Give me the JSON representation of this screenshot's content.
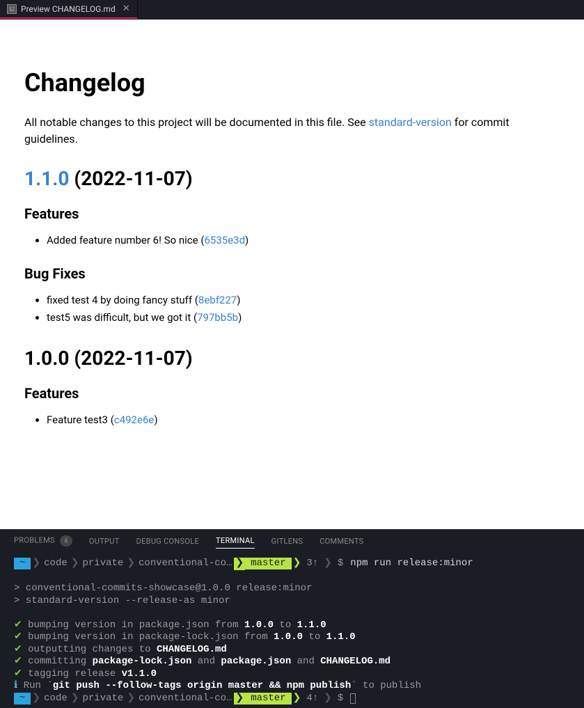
{
  "tab": {
    "title": "Preview CHANGELOG.md"
  },
  "changelog": {
    "title": "Changelog",
    "intro_pre": "All notable changes to this project will be documented in this file. See ",
    "intro_link": "standard-version",
    "intro_post": " for commit guidelines.",
    "v110": {
      "version": "1.1.0",
      "date": "(2022-11-07)",
      "features_heading": "Features",
      "features": [
        {
          "text": "Added feature number 6! So nice (",
          "hash": "6535e3d",
          "close": ")"
        }
      ],
      "bugfixes_heading": "Bug Fixes",
      "bugfixes": [
        {
          "text": "fixed test 4 by doing fancy stuff (",
          "hash": "8ebf227",
          "close": ")"
        },
        {
          "text": "test5 was difficult, but we got it (",
          "hash": "797bb5b",
          "close": ")"
        }
      ]
    },
    "v100": {
      "heading": "1.0.0 (2022-11-07)",
      "features_heading": "Features",
      "features": [
        {
          "text": "Feature test3 (",
          "hash": "c492e6e",
          "close": ")"
        }
      ]
    }
  },
  "panel": {
    "problems": "PROBLEMS",
    "problems_count": "4",
    "output": "OUTPUT",
    "debug": "DEBUG CONSOLE",
    "terminal": "TERMINAL",
    "gitlens": "GITLENS",
    "comments": "COMMENTS"
  },
  "terminal": {
    "prompt1": {
      "home": "~",
      "p1": "code",
      "p2": "private",
      "p3": "conventional-co…",
      "branch": "master",
      "count": "3",
      "cmd": "npm run release:minor"
    },
    "lines": {
      "l1": "> conventional-commits-showcase@1.0.0 release:minor",
      "l2": "> standard-version --release-as minor",
      "l3_a": " bumping version in package.json from ",
      "l3_b": "1.0.0",
      "l3_c": " to ",
      "l3_d": "1.1.0",
      "l4_a": " bumping version in package-lock.json from ",
      "l4_b": "1.0.0",
      "l4_c": " to ",
      "l4_d": "1.1.0",
      "l5_a": " outputting changes to ",
      "l5_b": "CHANGELOG.md",
      "l6_a": " committing ",
      "l6_b": "package-lock.json",
      "l6_c": " and ",
      "l6_d": "package.json",
      "l6_e": " and ",
      "l6_f": "CHANGELOG.md",
      "l7_a": " tagging release ",
      "l7_b": "v1.1.0",
      "l8_a": " Run `",
      "l8_b": "git push --follow-tags origin master && npm publish",
      "l8_c": "` to publish"
    },
    "prompt2": {
      "home": "~",
      "p1": "code",
      "p2": "private",
      "p3": "conventional-co…",
      "branch": "master",
      "count": "4"
    }
  }
}
